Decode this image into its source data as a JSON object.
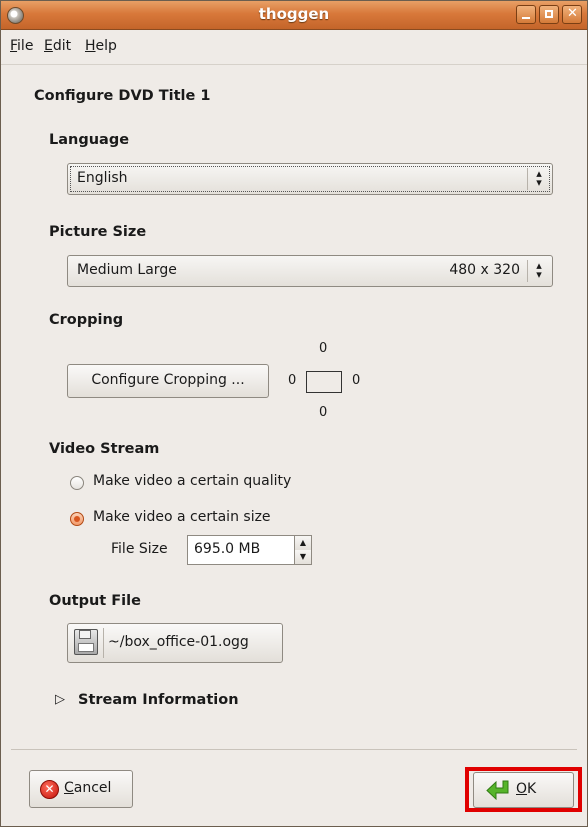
{
  "window": {
    "title": "thoggen"
  },
  "menu": [
    {
      "mnemonic": "F",
      "rest": "ile"
    },
    {
      "mnemonic": "E",
      "rest": "dit"
    },
    {
      "mnemonic": "H",
      "rest": "elp"
    }
  ],
  "main": {
    "heading": "Configure DVD Title 1"
  },
  "language": {
    "label": "Language",
    "value": "English"
  },
  "picture": {
    "label": "Picture Size",
    "value": "Medium Large",
    "dims": "480 x 320"
  },
  "cropping": {
    "label": "Cropping",
    "button": "Configure Cropping ...",
    "top": "0",
    "left": "0",
    "right": "0",
    "bottom": "0"
  },
  "video": {
    "label": "Video Stream",
    "option_quality": "Make video a certain quality",
    "option_size": "Make video a certain size",
    "selected": "size",
    "filesize_label": "File Size",
    "filesize_value": "695.0 MB"
  },
  "output": {
    "label": "Output File",
    "path": "~/box_office-01.ogg"
  },
  "stream_info": {
    "label": "Stream Information",
    "expanded": false
  },
  "footer": {
    "cancel_mnemonic": "C",
    "cancel_rest": "ancel",
    "ok_mnemonic": "O",
    "ok_rest": "K"
  },
  "colors": {
    "titlebar": "#d8783a",
    "highlight_border": "#e00000",
    "radio_on": "#d8561f"
  }
}
